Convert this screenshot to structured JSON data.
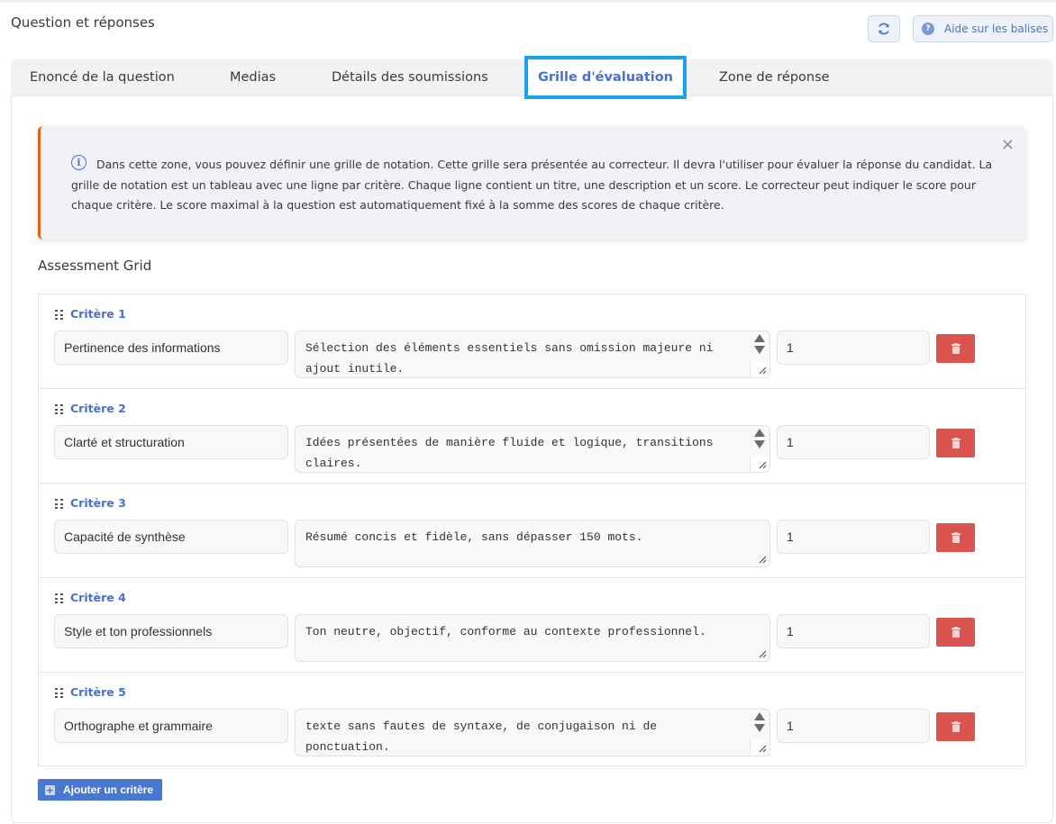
{
  "header": {
    "title": "Question et réponses",
    "help_label": "Aide sur les balises",
    "refresh_icon": "refresh-icon",
    "help_icon": "question-circle-icon"
  },
  "tabs": [
    {
      "label": "Enoncé de la question",
      "active": false
    },
    {
      "label": "Medias",
      "active": false
    },
    {
      "label": "Détails des soumissions",
      "active": false
    },
    {
      "label": "Grille d'évaluation",
      "active": true
    },
    {
      "label": "Zone de réponse",
      "active": false
    }
  ],
  "alert": {
    "text": "Dans cette zone, vous pouvez définir une grille de notation. Cette grille sera présentée au correcteur. Il devra l'utiliser pour évaluer la réponse du candidat. La grille de notation est un tableau avec une ligne par critère. Chaque ligne contient un titre, une description et un score. Le correcteur peut indiquer le score pour chaque critère. Le score maximal à la question est automatiquement fixé à la somme des scores de chaque critère.",
    "close_glyph": "×",
    "accent_color": "#e0621b"
  },
  "grid": {
    "title": "Assessment Grid",
    "criteria": [
      {
        "label": "Critère 1",
        "title": "Pertinence des informations",
        "description": "Sélection des éléments essentiels sans omission majeure ni ajout inutile.",
        "score": "1"
      },
      {
        "label": "Critère 2",
        "title": "Clarté et structuration",
        "description": "Idées présentées de manière fluide et logique, transitions claires.",
        "score": "1"
      },
      {
        "label": "Critère 3",
        "title": "Capacité de synthèse",
        "description": "Résumé concis et fidèle, sans dépasser 150 mots.",
        "score": "1"
      },
      {
        "label": "Critère 4",
        "title": "Style et ton professionnels",
        "description": "Ton neutre, objectif, conforme au contexte professionnel.",
        "score": "1"
      },
      {
        "label": "Critère 5",
        "title": "Orthographe et grammaire",
        "description": "texte sans fautes de syntaxe, de conjugaison ni de ponctuation.",
        "score": "1"
      }
    ]
  },
  "add_button": {
    "label": "Ajouter un critère"
  },
  "colors": {
    "accent": "#4a6fd1",
    "active_tab_border": "#1aa3e6",
    "delete": "#d9534f"
  }
}
